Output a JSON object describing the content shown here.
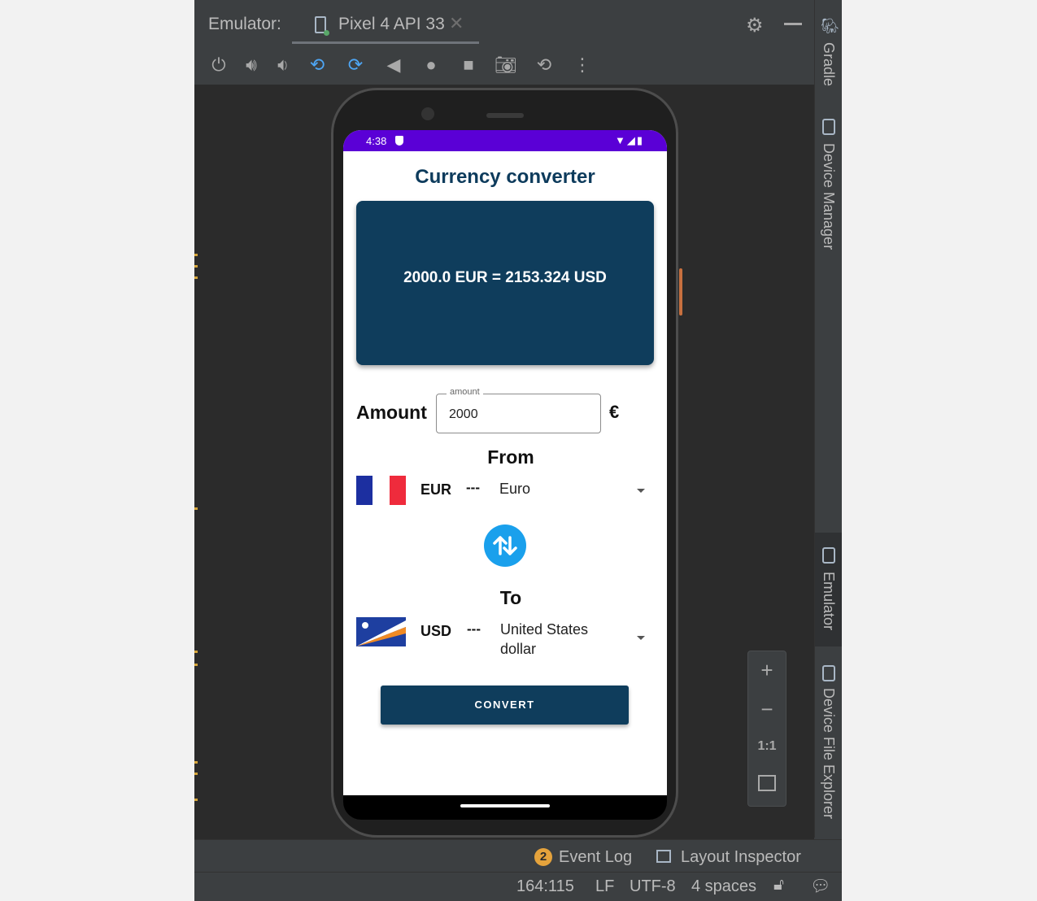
{
  "ide": {
    "emulator_label": "Emulator:",
    "device_tab": "Pixel 4 API 33",
    "close_glyph": "✕",
    "right_tabs": [
      "Gradle",
      "Device Manager",
      "Emulator",
      "Device File Explorer"
    ],
    "zoom": {
      "plus": "+",
      "minus": "−",
      "one_to_one": "1:1"
    },
    "bottom": {
      "event_log_count": "2",
      "event_log": "Event Log",
      "layout_inspector": "Layout Inspector"
    },
    "statusbar": {
      "position": "164:115",
      "line_sep": "LF",
      "encoding": "UTF-8",
      "indent": "4 spaces"
    },
    "toolbar_icons": [
      "power-icon",
      "volume-up-icon",
      "volume-down-icon",
      "rotate-left-icon",
      "rotate-right-icon",
      "back-icon",
      "home-icon",
      "overview-icon",
      "camera-icon",
      "snapshot-icon",
      "more-icon"
    ]
  },
  "phone": {
    "status_time": "4:38",
    "app": {
      "title": "Currency converter",
      "result": "2000.0 EUR = 2153.324 USD",
      "amount_label": "Amount",
      "amount_hint": "amount",
      "amount_value": "2000",
      "currency_symbol": "€",
      "from_label": "From",
      "from": {
        "code": "EUR",
        "separator": "---",
        "name": "Euro"
      },
      "to_label": "To",
      "to": {
        "code": "USD",
        "separator": "---",
        "name": "United States dollar"
      },
      "convert_button": "CONVERT"
    }
  },
  "colors": {
    "primary": "#0f3d5c",
    "status_bar": "#5a00d6",
    "swap_button": "#1aa0ec",
    "ide_bg": "#3c3f41"
  }
}
